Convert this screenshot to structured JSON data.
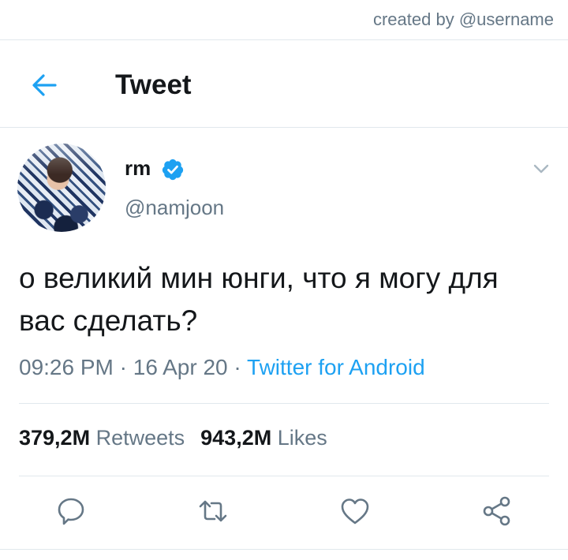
{
  "credit": "created by @username",
  "header": {
    "title": "Tweet"
  },
  "tweet": {
    "author_name": "rm",
    "author_handle": "@namjoon",
    "text": "о великий мин юнги, что я могу для вас сделать?",
    "time": "09:26 PM",
    "date": "16 Apr 20",
    "source": "Twitter for Android",
    "separator": "·"
  },
  "stats": {
    "retweets_count": "379,2M",
    "retweets_label": "Retweets",
    "likes_count": "943,2M",
    "likes_label": "Likes"
  },
  "colors": {
    "accent": "#1da1f2",
    "muted": "#657786",
    "text": "#14171a",
    "divider": "#e1e8ed"
  },
  "icons": [
    "back-arrow-icon",
    "verified-badge-icon",
    "chevron-down-icon",
    "reply-icon",
    "retweet-icon",
    "like-icon",
    "share-icon"
  ]
}
